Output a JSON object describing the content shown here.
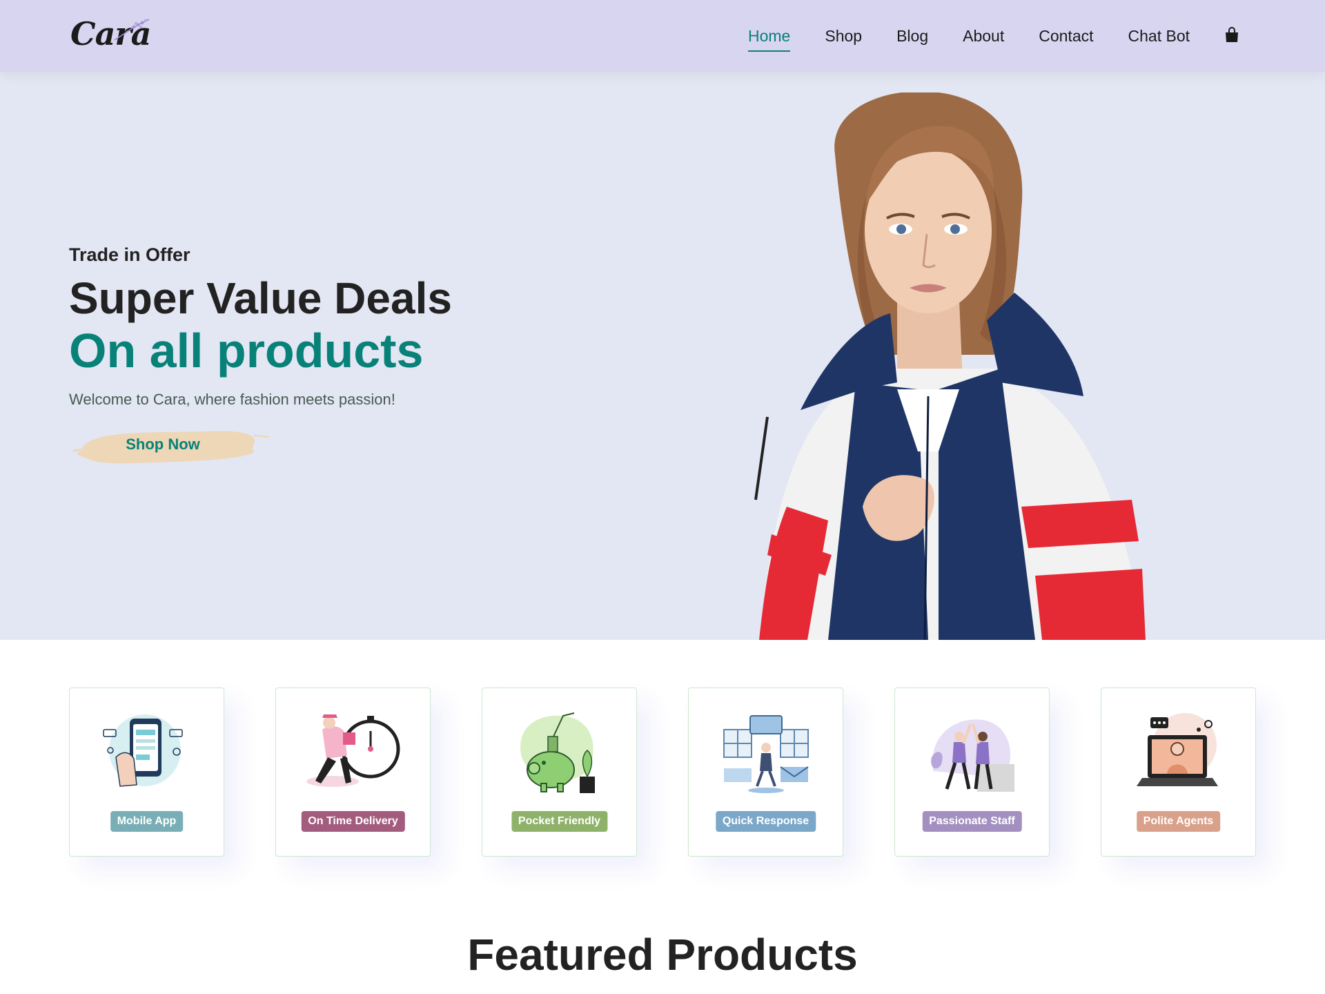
{
  "header": {
    "logo_text": "Cara",
    "nav": [
      {
        "label": "Home",
        "active": true
      },
      {
        "label": "Shop",
        "active": false
      },
      {
        "label": "Blog",
        "active": false
      },
      {
        "label": "About",
        "active": false
      },
      {
        "label": "Contact",
        "active": false
      },
      {
        "label": "Chat Bot",
        "active": false
      }
    ],
    "cart_icon": "shopping-bag-icon"
  },
  "hero": {
    "kicker": "Trade in Offer",
    "title": "Super Value Deals",
    "subtitle": "On all products",
    "description": "Welcome to Cara, where fashion meets passion!",
    "button_label": "Shop Now"
  },
  "features": [
    {
      "label": "Mobile App",
      "color": "#7aaeb6",
      "icon": "mobile-payment-icon"
    },
    {
      "label": "On Time Delivery",
      "color": "#a45c7e",
      "icon": "delivery-stopwatch-icon"
    },
    {
      "label": "Pocket Friendly",
      "color": "#8fb26a",
      "icon": "piggy-bank-icon"
    },
    {
      "label": "Quick Response",
      "color": "#7ba7c9",
      "icon": "quick-response-icon"
    },
    {
      "label": "Passionate Staff",
      "color": "#a390c0",
      "icon": "high-five-icon"
    },
    {
      "label": "Polite Agents",
      "color": "#d9a08a",
      "icon": "support-agent-icon"
    }
  ],
  "featured": {
    "title": "Featured Products"
  },
  "colors": {
    "accent": "#088178",
    "header_bg": "#d8d5f1",
    "hero_bg": "#e3e6f3"
  }
}
